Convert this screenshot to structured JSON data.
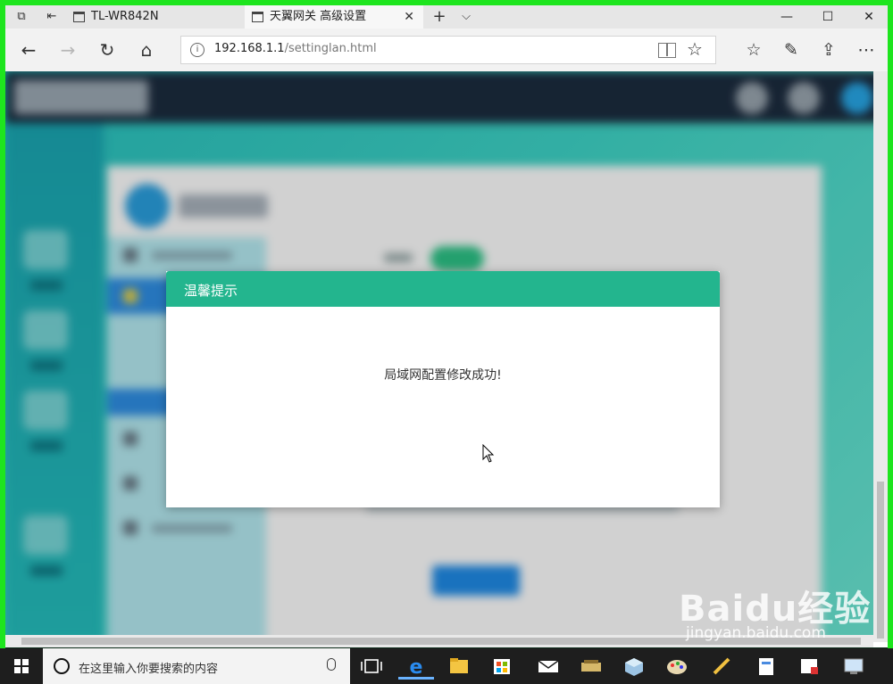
{
  "browser": {
    "tabs": [
      {
        "label": "TL-WR842N",
        "active": false
      },
      {
        "label": "天翼网关 高级设置",
        "active": true
      }
    ],
    "url": {
      "host": "192.168.1.1",
      "path": "/settinglan.html"
    }
  },
  "dialog": {
    "title": "温馨提示",
    "message": "局域网配置修改成功!"
  },
  "taskbar": {
    "search_placeholder": "在这里输入你要搜索的内容"
  },
  "watermark": {
    "brand": "Baidu经验",
    "site": "jingyan.baidu.com"
  },
  "colors": {
    "frame": "#1ee51e",
    "dialog_header": "#23b58e",
    "site_header": "#1c2c3f",
    "page_accent": "#28c2c0",
    "taskbar": "#1e1e1e"
  }
}
